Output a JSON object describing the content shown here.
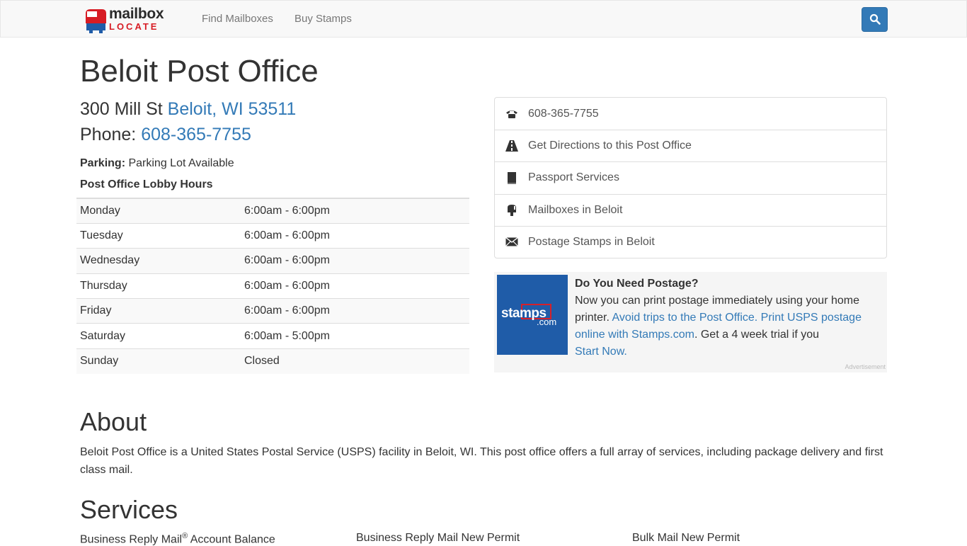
{
  "nav": {
    "logo_word1": "mailbox",
    "logo_word2": "LOCATE",
    "links": [
      "Find Mailboxes",
      "Buy Stamps"
    ]
  },
  "page": {
    "title": "Beloit Post Office",
    "street": "300 Mill St",
    "city_link": "Beloit, WI 53511",
    "phone_label": "Phone:",
    "phone": "608-365-7755",
    "parking_label": "Parking:",
    "parking_value": "Parking Lot Available",
    "hours_title": "Post Office Lobby Hours",
    "hours": [
      {
        "day": "Monday",
        "time": "6:00am - 6:00pm"
      },
      {
        "day": "Tuesday",
        "time": "6:00am - 6:00pm"
      },
      {
        "day": "Wednesday",
        "time": "6:00am - 6:00pm"
      },
      {
        "day": "Thursday",
        "time": "6:00am - 6:00pm"
      },
      {
        "day": "Friday",
        "time": "6:00am - 6:00pm"
      },
      {
        "day": "Saturday",
        "time": "6:00am - 5:00pm"
      },
      {
        "day": "Sunday",
        "time": "Closed"
      }
    ]
  },
  "links_list": [
    {
      "label": "608-365-7755",
      "icon": "phone-icon"
    },
    {
      "label": "Get Directions to this Post Office",
      "icon": "road-icon"
    },
    {
      "label": "Passport Services",
      "icon": "book-icon"
    },
    {
      "label": "Mailboxes in Beloit",
      "icon": "mailbox-icon"
    },
    {
      "label": "Postage Stamps in Beloit",
      "icon": "envelope-icon"
    }
  ],
  "ad": {
    "logo_text": "stamps",
    "logo_com": ".com",
    "heading": "Do You Need Postage?",
    "text1": "Now you can print postage immediately using your home printer.",
    "link1": "Avoid trips to the Post Office. Print USPS postage online with Stamps.com",
    "text2": ". Get a 4 week trial if you",
    "link2": "Start Now.",
    "label": "Advertisement"
  },
  "about": {
    "heading": "About",
    "text": "Beloit Post Office is a United States Postal Service (USPS) facility in Beloit, WI. This post office offers a full array of services, including package delivery and first class mail."
  },
  "services": {
    "heading": "Services",
    "items": [
      "Business Reply Mail",
      "Account Balance",
      "Business Reply Mail New Permit",
      "Bulk Mail New Permit"
    ],
    "reg_mark": "®"
  },
  "colors": {
    "link": "#337ab7",
    "brand_red": "#d71c24",
    "stamps_blue": "#1f5ca8"
  }
}
